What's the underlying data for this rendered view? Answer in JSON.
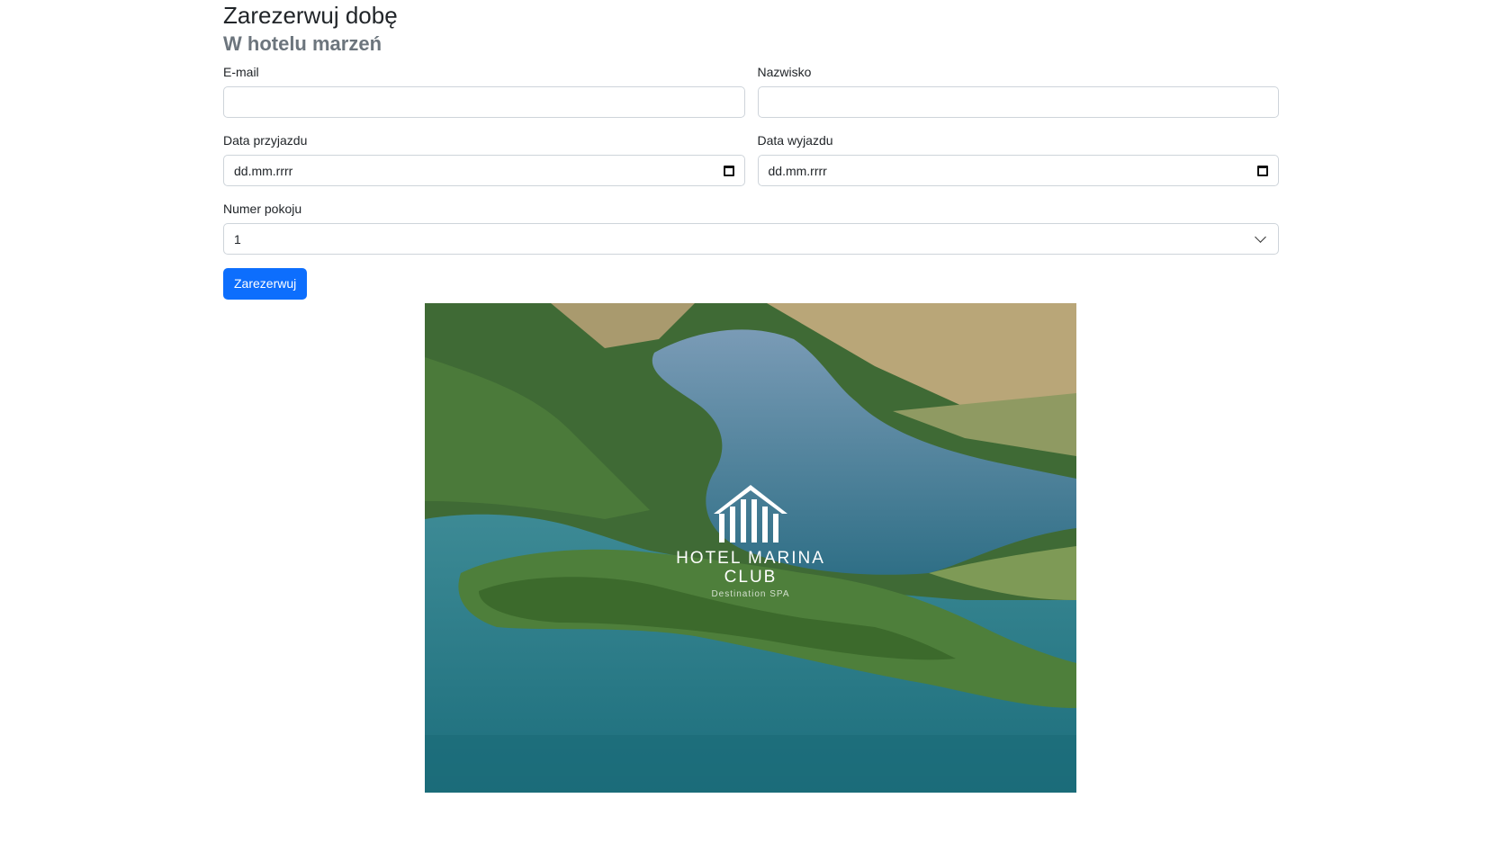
{
  "page": {
    "title": "Zarezerwuj dobę",
    "subtitle": "W hotelu marzeń"
  },
  "form": {
    "email": {
      "label": "E-mail",
      "value": ""
    },
    "surname": {
      "label": "Nazwisko",
      "value": ""
    },
    "arrival": {
      "label": "Data przyjazdu",
      "value": "dd.mm.rrrr",
      "icon": "calendar-icon"
    },
    "departure": {
      "label": "Data wyjazdu",
      "value": "dd.mm.rrrr",
      "icon": "calendar-icon"
    },
    "room": {
      "label": "Numer pokoju",
      "selected": "1",
      "icon": "chevron-down-icon"
    },
    "submit_label": "Zarezerwuj"
  },
  "hero": {
    "logo_name_line1": "HOTEL MARINA",
    "logo_name_line2": "CLUB",
    "logo_tagline": "Destination SPA"
  },
  "colors": {
    "primary": "#0d6efd",
    "subtitle": "#6c757d",
    "border": "#ced4da"
  }
}
